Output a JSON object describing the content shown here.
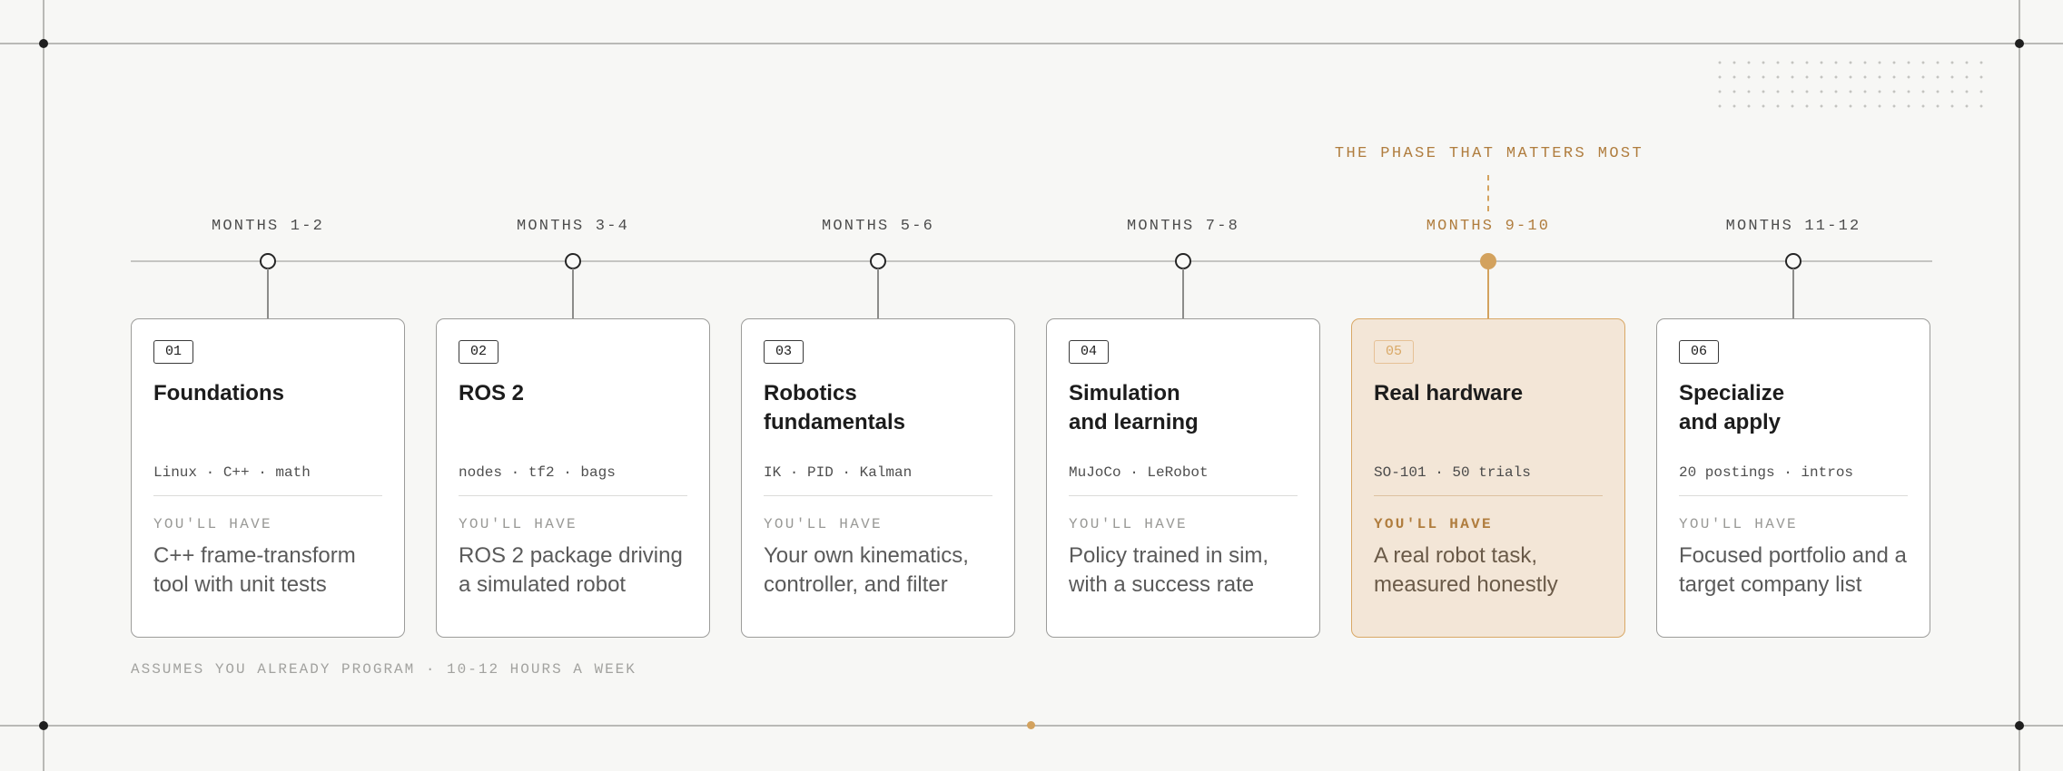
{
  "callout": "THE PHASE THAT MATTERS MOST",
  "footnote": "ASSUMES YOU ALREADY PROGRAM · 10-12 HOURS A WEEK",
  "accent_color": "#d3a25e",
  "phases": [
    {
      "months": "MONTHS 1-2",
      "number": "01",
      "title": "Foundations",
      "tags": "Linux · C++ · math",
      "have_label": "YOU'LL HAVE",
      "have_text": "C++ frame-transform tool with unit tests",
      "highlight": false
    },
    {
      "months": "MONTHS 3-4",
      "number": "02",
      "title": "ROS 2",
      "tags": "nodes · tf2 · bags",
      "have_label": "YOU'LL HAVE",
      "have_text": "ROS 2 package driving a simulated robot",
      "highlight": false
    },
    {
      "months": "MONTHS 5-6",
      "number": "03",
      "title": "Robotics\nfundamentals",
      "tags": "IK · PID · Kalman",
      "have_label": "YOU'LL HAVE",
      "have_text": "Your own kinematics, controller, and filter",
      "highlight": false
    },
    {
      "months": "MONTHS 7-8",
      "number": "04",
      "title": "Simulation\nand learning",
      "tags": "MuJoCo · LeRobot",
      "have_label": "YOU'LL HAVE",
      "have_text": "Policy trained in sim, with a success rate",
      "highlight": false
    },
    {
      "months": "MONTHS 9-10",
      "number": "05",
      "title": "Real hardware",
      "tags": "SO-101 · 50 trials",
      "have_label": "YOU'LL HAVE",
      "have_text": "A real robot task, measured honestly",
      "highlight": true
    },
    {
      "months": "MONTHS 11-12",
      "number": "06",
      "title": "Specialize\nand apply",
      "tags": "20 postings · intros",
      "have_label": "YOU'LL HAVE",
      "have_text": "Focused portfolio and a target company list",
      "highlight": false
    }
  ]
}
